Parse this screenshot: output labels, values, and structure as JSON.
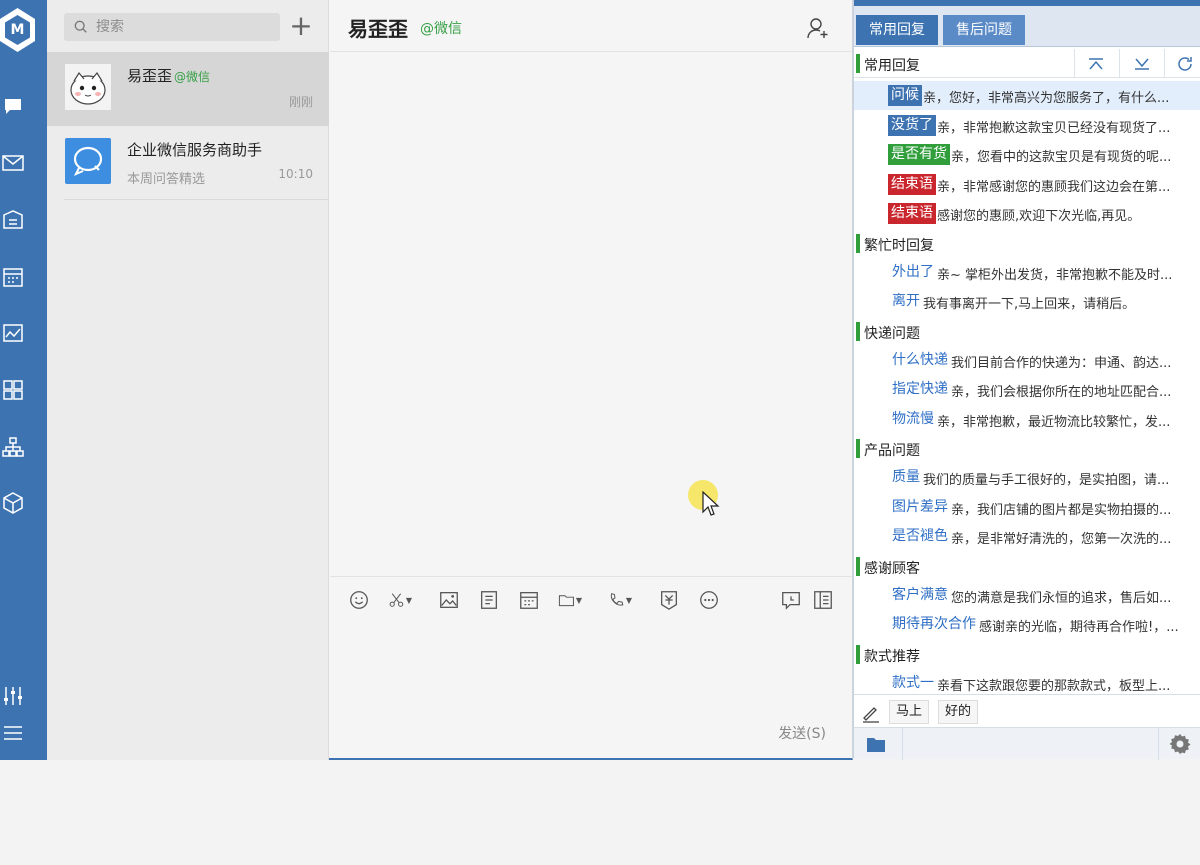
{
  "search": {
    "placeholder": "搜索"
  },
  "conversations": [
    {
      "name": "易歪歪",
      "tag": "@微信",
      "preview": "",
      "time": "刚刚"
    },
    {
      "name": "企业微信服务商助手",
      "tag": "",
      "preview": "本周问答精选",
      "time": "10:10"
    }
  ],
  "chat": {
    "title": "易歪歪",
    "title_tag": "@微信",
    "send_label": "发送(S)"
  },
  "side": {
    "tabs": [
      "常用回复",
      "售后问题"
    ],
    "groups": [
      {
        "label": "常用回复",
        "items": [
          {
            "key": "问候",
            "text": "亲，您好，非常高兴为您服务了，有什么...",
            "style": "blue"
          },
          {
            "key": "没货了",
            "text": "亲，非常抱歉这款宝贝已经没有现货了...",
            "style": "blue"
          },
          {
            "key": "是否有货",
            "text": "亲，您看中的这款宝贝是有现货的呢...",
            "style": "green"
          },
          {
            "key": "结束语",
            "text": "亲，非常感谢您的惠顾我们这边会在第...",
            "style": "red"
          },
          {
            "key": "结束语",
            "text": "感谢您的惠顾,欢迎下次光临,再见。",
            "style": "red"
          }
        ]
      },
      {
        "label": "繁忙时回复",
        "items": [
          {
            "key": "外出了",
            "text": "亲~ 掌柜外出发货，非常抱歉不能及时...",
            "style": "plain"
          },
          {
            "key": "离开",
            "text": "我有事离开一下,马上回来，请稍后。",
            "style": "plain"
          }
        ]
      },
      {
        "label": "快递问题",
        "items": [
          {
            "key": "什么快递",
            "text": "我们目前合作的快递为：申通、韵达...",
            "style": "plain"
          },
          {
            "key": "指定快递",
            "text": "亲，我们会根据你所在的地址匹配合...",
            "style": "plain"
          },
          {
            "key": "物流慢",
            "text": "亲，非常抱歉，最近物流比较繁忙，发...",
            "style": "plain"
          }
        ]
      },
      {
        "label": "产品问题",
        "items": [
          {
            "key": "质量",
            "text": "我们的质量与手工很好的，是实拍图，请...",
            "style": "plain"
          },
          {
            "key": "图片差异",
            "text": "亲，我们店铺的图片都是实物拍摄的...",
            "style": "plain"
          },
          {
            "key": "是否褪色",
            "text": "亲，是非常好清洗的，您第一次洗的...",
            "style": "plain"
          }
        ]
      },
      {
        "label": "感谢顾客",
        "items": [
          {
            "key": "客户满意",
            "text": "您的满意是我们永恒的追求，售后如...",
            "style": "plain"
          },
          {
            "key": "期待再次合作",
            "text": "感谢亲的光临，期待再合作啦!，...",
            "style": "plain"
          }
        ]
      },
      {
        "label": "款式推荐",
        "items": [
          {
            "key": "款式一",
            "text": "亲看下这款跟您要的那款款式，板型上...",
            "style": "plain"
          }
        ]
      }
    ],
    "quick": [
      "马上",
      "好的"
    ]
  },
  "colors": {
    "rail": "#3d73b1",
    "blue_tag": "#3d73b1",
    "green_tag": "#2f9e3b",
    "red_tag": "#c9262e"
  }
}
